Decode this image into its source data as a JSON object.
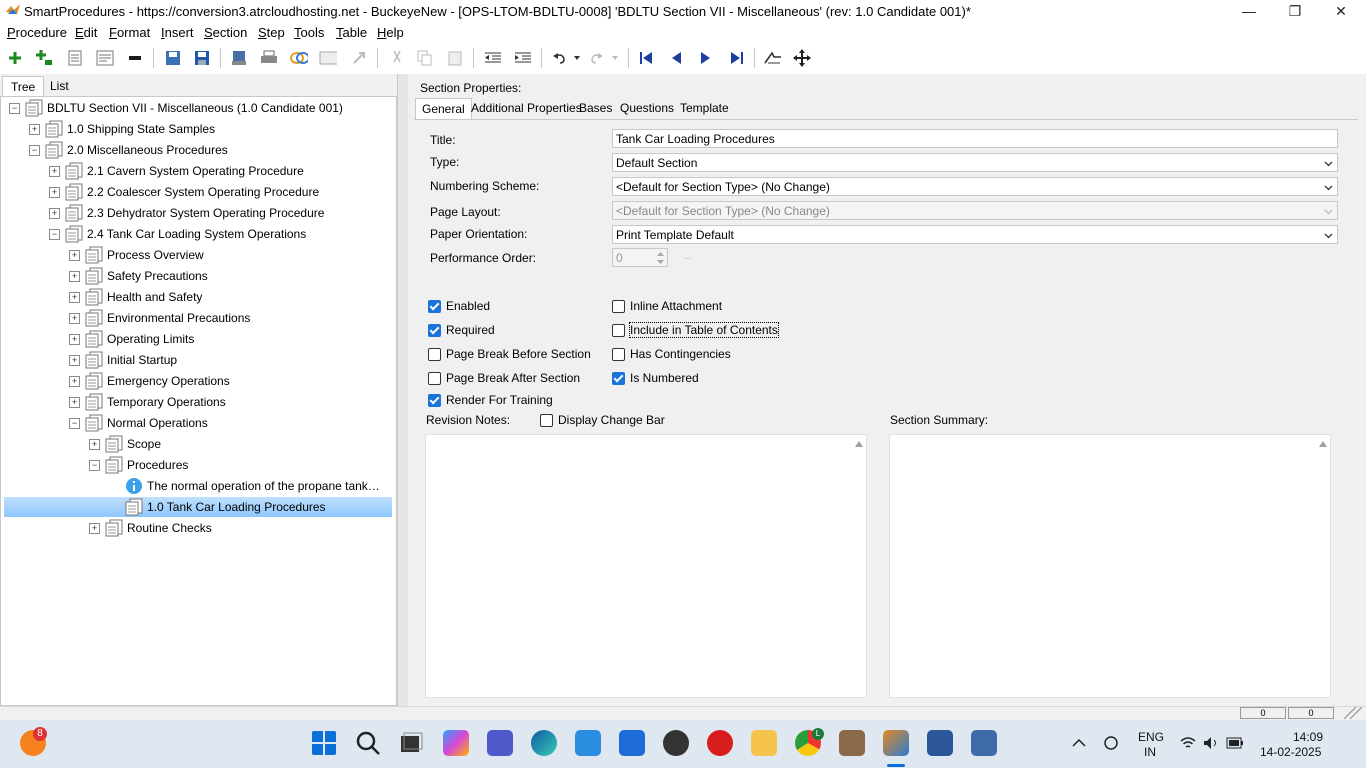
{
  "window": {
    "title": "SmartProcedures - https://conversion3.atrcloudhosting.net - BuckeyeNew - [OPS-LTOM-BDLTU-0008] 'BDLTU Section VII - Miscellaneous' (rev: 1.0 Candidate 001)*",
    "minimize": "—",
    "maximize": "❐",
    "close": "✕"
  },
  "menu": [
    {
      "label": "Procedure",
      "u": "P",
      "rest": "rocedure"
    },
    {
      "label": "Edit",
      "u": "E",
      "rest": "dit"
    },
    {
      "label": "Format",
      "u": "F",
      "rest": "ormat"
    },
    {
      "label": "Insert",
      "u": "I",
      "rest": "nsert"
    },
    {
      "label": "Section",
      "u": "S",
      "rest": "ection"
    },
    {
      "label": "Step",
      "u": "S",
      "rest": "tep"
    },
    {
      "label": "Tools",
      "u": "T",
      "rest": "ools"
    },
    {
      "label": "Table",
      "u": "T",
      "rest": "able"
    },
    {
      "label": "Help",
      "u": "H",
      "rest": "elp"
    }
  ],
  "left_tabs": [
    "Tree",
    "List"
  ],
  "tree": [
    {
      "label": "BDLTU Section VII - Miscellaneous (1.0 Candidate 001)",
      "level": 0,
      "exp": "−",
      "icon": "procedure-icon"
    },
    {
      "label": "1.0 Shipping State Samples",
      "level": 1,
      "exp": "+",
      "icon": "section-icon"
    },
    {
      "label": "2.0 Miscellaneous Procedures",
      "level": 1,
      "exp": "−",
      "icon": "section-icon"
    },
    {
      "label": "2.1 Cavern System Operating Procedure",
      "level": 2,
      "exp": "+",
      "icon": "section-icon"
    },
    {
      "label": "2.2 Coalescer System Operating Procedure",
      "level": 2,
      "exp": "+",
      "icon": "section-icon"
    },
    {
      "label": "2.3 Dehydrator System Operating Procedure",
      "level": 2,
      "exp": "+",
      "icon": "section-icon"
    },
    {
      "label": "2.4 Tank Car Loading System Operations",
      "level": 2,
      "exp": "−",
      "icon": "section-icon"
    },
    {
      "label": "Process Overview",
      "level": 3,
      "exp": "+",
      "icon": "section-icon"
    },
    {
      "label": "Safety Precautions",
      "level": 3,
      "exp": "+",
      "icon": "section-icon"
    },
    {
      "label": "Health and Safety",
      "level": 3,
      "exp": "+",
      "icon": "section-icon"
    },
    {
      "label": "Environmental Precautions",
      "level": 3,
      "exp": "+",
      "icon": "section-icon"
    },
    {
      "label": "Operating Limits",
      "level": 3,
      "exp": "+",
      "icon": "section-icon"
    },
    {
      "label": "Initial Startup",
      "level": 3,
      "exp": "+",
      "icon": "section-icon"
    },
    {
      "label": "Emergency Operations",
      "level": 3,
      "exp": "+",
      "icon": "section-icon"
    },
    {
      "label": "Temporary Operations",
      "level": 3,
      "exp": "+",
      "icon": "section-icon"
    },
    {
      "label": "Normal Operations",
      "level": 3,
      "exp": "−",
      "icon": "section-icon"
    },
    {
      "label": "Scope",
      "level": 4,
      "exp": "+",
      "icon": "section-icon"
    },
    {
      "label": "Procedures",
      "level": 4,
      "exp": "−",
      "icon": "section-icon"
    },
    {
      "label": "The normal operation of the propane tank…",
      "level": 5,
      "exp": "",
      "icon": "info-icon"
    },
    {
      "label": "1.0 Tank Car Loading Procedures",
      "level": 5,
      "exp": "",
      "icon": "section-icon",
      "selected": true
    },
    {
      "label": "Routine Checks",
      "level": 4,
      "exp": "+",
      "icon": "section-icon"
    }
  ],
  "right": {
    "header": "Section Properties:",
    "tabs": [
      "General",
      "Additional Properties",
      "Bases",
      "Questions",
      "Template"
    ],
    "fields": {
      "title_label": "Title:",
      "title_value": "Tank Car Loading Procedures",
      "type_label": "Type:",
      "type_value": "Default Section",
      "numbering_label": "Numbering Scheme:",
      "numbering_value": "<Default for Section Type> (No Change)",
      "layout_label": "Page Layout:",
      "layout_value": "<Default for Section Type> (No Change)",
      "orientation_label": "Paper Orientation:",
      "orientation_value": "Print Template Default",
      "perf_label": "Performance Order:",
      "perf_value": "0",
      "perf_button": "..."
    },
    "checkboxes": [
      {
        "label": "Enabled",
        "checked": true
      },
      {
        "label": "Inline Attachment",
        "checked": false
      },
      {
        "label": "Required",
        "checked": true
      },
      {
        "label": "Include in Table of Contents",
        "checked": false
      },
      {
        "label": "Page Break Before Section",
        "checked": false
      },
      {
        "label": "Has Contingencies",
        "checked": false
      },
      {
        "label": "Page Break After Section",
        "checked": false
      },
      {
        "label": "Is Numbered",
        "checked": true
      },
      {
        "label": "Render For Training",
        "checked": true
      }
    ],
    "revision_notes_label": "Revision Notes:",
    "display_change_bar": {
      "label": "Display Change Bar",
      "checked": false
    },
    "section_summary_label": "Section Summary:"
  },
  "statusbar": {
    "box1": "0",
    "box2": "0"
  },
  "taskbar": {
    "notification_count": "8",
    "lang": "ENG",
    "region": "IN",
    "time": "14:09",
    "date": "14-02-2025",
    "chrome_badge": "L"
  },
  "colors": {
    "accent": "#1a73d9",
    "selection": "#99cdfb"
  }
}
